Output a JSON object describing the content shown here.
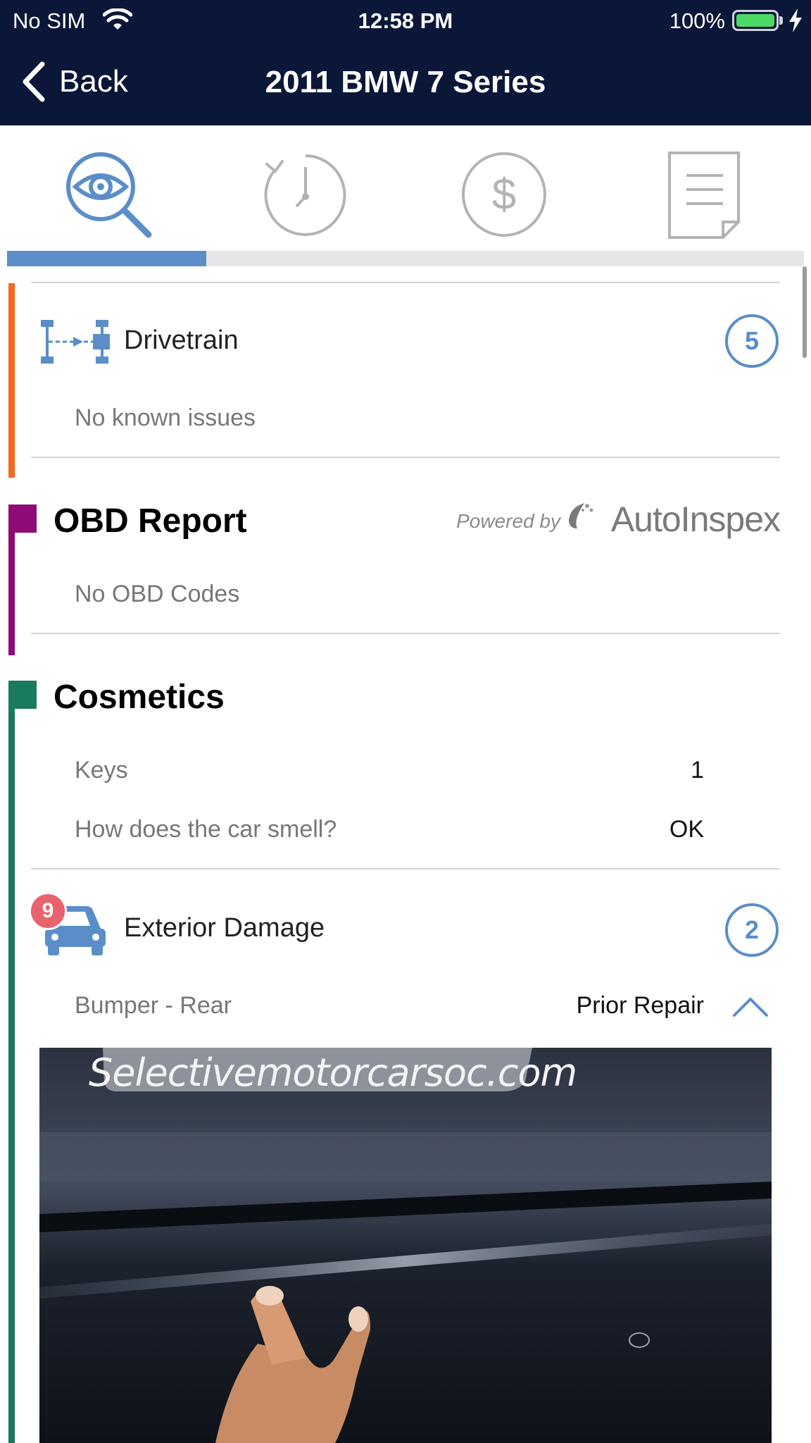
{
  "status_bar": {
    "carrier": "No SIM",
    "time": "12:58 PM",
    "battery_percent": "100%"
  },
  "nav": {
    "back_label": "Back",
    "title": "2011 BMW 7 Series"
  },
  "tabs": [
    {
      "name": "inspection",
      "icon": "eye-search-icon",
      "active": true
    },
    {
      "name": "history",
      "icon": "clock-history-icon",
      "active": false
    },
    {
      "name": "pricing",
      "icon": "dollar-icon",
      "active": false
    },
    {
      "name": "documents",
      "icon": "document-icon",
      "active": false
    }
  ],
  "progress": {
    "fraction": 0.25,
    "active_color": "#5b8ec8",
    "track_color": "#e6e6e8"
  },
  "drivetrain": {
    "title": "Drivetrain",
    "count": "5",
    "status": "No known issues",
    "accent": "#f26a21"
  },
  "obd": {
    "title": "OBD Report",
    "powered_by": "Powered by",
    "brand": "AutoInspex",
    "status": "No OBD Codes",
    "accent": "#8e0a74"
  },
  "cosmetics": {
    "title": "Cosmetics",
    "accent": "#1a7a5e",
    "rows": [
      {
        "label": "Keys",
        "value": "1"
      },
      {
        "label": "How does the car smell?",
        "value": "OK"
      }
    ],
    "exterior_damage": {
      "title": "Exterior Damage",
      "badge": "9",
      "count": "2",
      "item": {
        "label": "Bumper - Rear",
        "value": "Prior Repair"
      },
      "photo_caption": "Selectivemotorcarsoc.com"
    }
  }
}
